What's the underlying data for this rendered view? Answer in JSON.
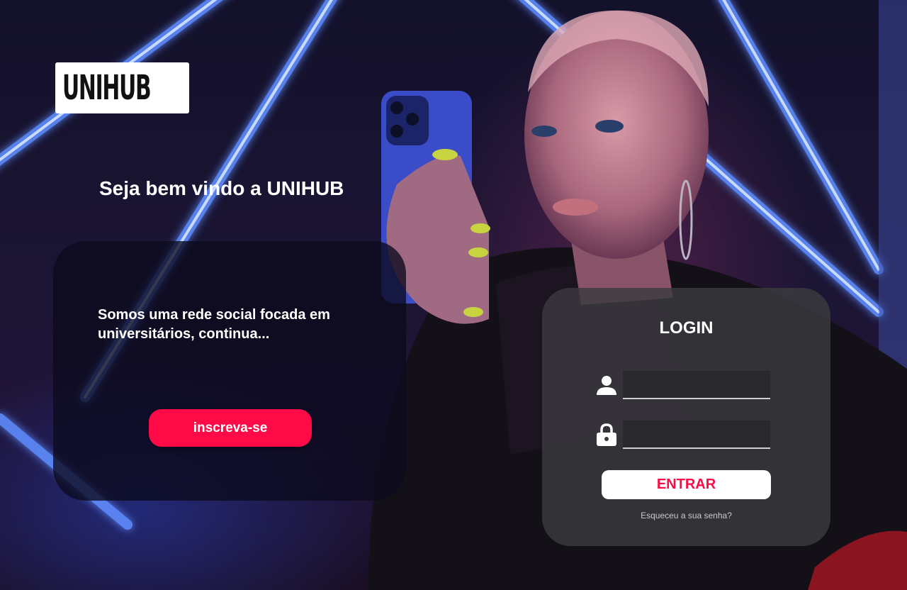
{
  "brand": {
    "logo_text": "UNIHUB"
  },
  "hero": {
    "welcome": "Seja bem vindo a UNIHUB",
    "description": "Somos uma rede social focada em universitários, continua...",
    "signup_label": "inscreva-se"
  },
  "login": {
    "title": "LOGIN",
    "username_placeholder": "",
    "password_placeholder": "",
    "submit_label": "ENTRAR",
    "forgot_label": "Esqueceu a sua senha?"
  },
  "icons": {
    "user": "user-icon",
    "password": "lock-icon",
    "logo": "people-group-icon"
  },
  "colors": {
    "accent": "#ff0a47",
    "card_dark": "#0c0a1e",
    "card_login": "#3a3a3e",
    "text": "#ffffff"
  }
}
